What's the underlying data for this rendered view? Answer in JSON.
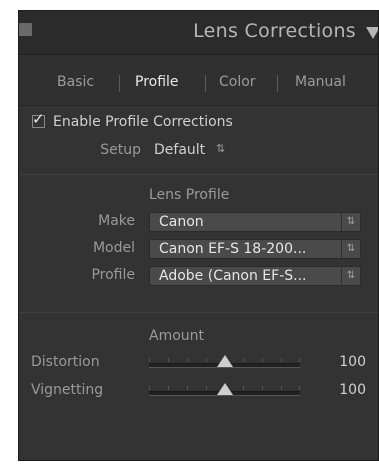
{
  "panel": {
    "title": "Lens Corrections"
  },
  "tabs": [
    {
      "label": "Basic",
      "active": false
    },
    {
      "label": "Profile",
      "active": true
    },
    {
      "label": "Color",
      "active": false
    },
    {
      "label": "Manual",
      "active": false
    }
  ],
  "enable": {
    "label": "Enable Profile Corrections",
    "checked": true,
    "setup_label": "Setup",
    "setup_value": "Default",
    "setup_arrow": "⇅"
  },
  "lens_profile": {
    "heading": "Lens Profile",
    "make_label": "Make",
    "make_value": "Canon",
    "model_label": "Model",
    "model_value": "Canon EF-S 18-200...",
    "profile_label": "Profile",
    "profile_value": "Adobe (Canon EF-S..."
  },
  "amount": {
    "heading": "Amount",
    "distortion_label": "Distortion",
    "distortion_value": "100",
    "distortion_level": 0.5,
    "vignetting_label": "Vignetting",
    "vignetting_value": "100",
    "vignetting_level": 0.5
  },
  "colors": {
    "panel_bg": "#333333",
    "header_bg": "#2b2b2b",
    "text": "#d0d0d0"
  },
  "icons": {
    "collapse": "triangle-down-icon",
    "panel_switch": "panel-switch-icon",
    "check": "checkmark-icon",
    "updown": "updown-arrows-icon"
  }
}
